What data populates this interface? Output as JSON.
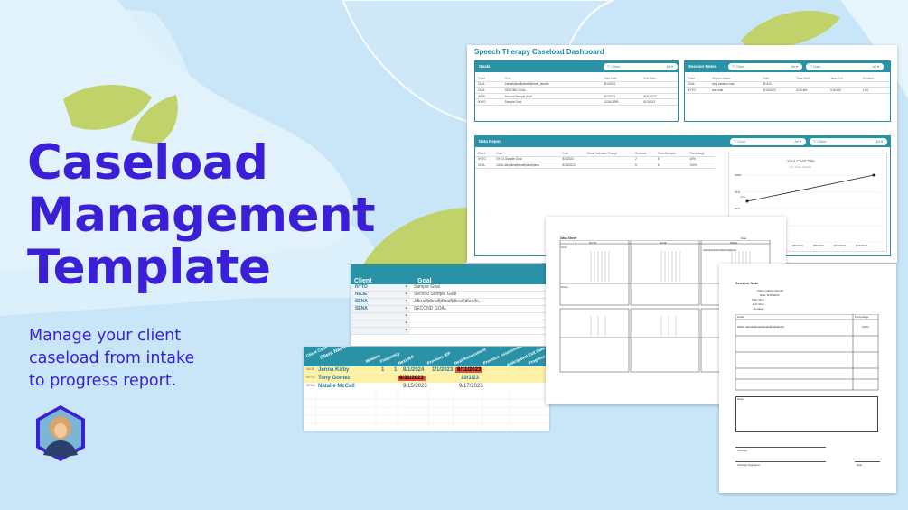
{
  "hero": {
    "title_line1": "Caseload",
    "title_line2": "Management",
    "title_line3": "Template",
    "subtitle_line1": "Manage your client",
    "subtitle_line2": "caseload from intake",
    "subtitle_line3": "to progress report."
  },
  "colors": {
    "accent": "#3a1fd6",
    "teal": "#2a92a6",
    "bg": "#c9e6f8",
    "olive": "#c2d26a"
  },
  "dashboard": {
    "title": "Speech Therapy Caseload Dashboard",
    "goals_panel": {
      "title": "Goals",
      "filter_label": "Client",
      "filter_value": "All",
      "headers": [
        "Client",
        "Goal",
        "Start Date",
        "End Date"
      ],
      "rows": [
        [
          "CIAA",
          "Jdkraif|dkraifl|dkraifl|dkraifl_dkraifo",
          "8/1/2023",
          ""
        ],
        [
          "CIAA",
          "SECOND GOAL",
          "",
          ""
        ],
        [
          "NAJE",
          "Second Sample Goal",
          "8/1/2023",
          "8/31/2023"
        ],
        [
          "NYTO",
          "Sample Goal",
          "12/31/1899",
          "8/1/2023"
        ]
      ]
    },
    "notes_panel": {
      "title": "Session Notes",
      "filter1_label": "Client",
      "filter1_value": "All",
      "filter2_label": "Date",
      "filter2_value": "All",
      "headers": [
        "Client",
        "Session Notes",
        "Date",
        "Time Start",
        "Time End",
        "Duration"
      ],
      "rows": [
        [
          "CINA",
          "long session note",
          "8/10/23",
          "",
          "",
          ""
        ],
        [
          "NYTO",
          "test note",
          "8/15/2023",
          "8:30 AM",
          "9:30 AM",
          "1:00"
        ]
      ]
    },
    "data_panel": {
      "title": "Data Report",
      "filter1_label": "Goal",
      "filter1_value": "All",
      "filter2_label": "Client",
      "filter2_value": "All",
      "headers": [
        "Client",
        "Goal",
        "Date",
        "Mode Indicates Prompt",
        "Success",
        "Total Attempts",
        "Percentage"
      ],
      "rows": [
        [
          "NYTO",
          "NYTO-Sample Goal",
          "8/3/2023",
          "",
          "2",
          "5",
          "40%"
        ],
        [
          "CINA",
          "CINA-Jdkr|dkraif|dkraif|dkraif|dkra",
          "8/15/2023",
          "",
          "6",
          "6",
          "100%"
        ]
      ],
      "chart": {
        "title": "Your Chart Title",
        "subtitle": "Your Chart Subtitle",
        "y_ticks": [
          "100%",
          "75%",
          "50%"
        ],
        "x_ticks": [
          "8/3/2023",
          "8/6/2023",
          "8/9/2023",
          "8/12/2023",
          "8/15/2023"
        ],
        "label_40": "40%"
      }
    }
  },
  "goals_sheet": {
    "col_client": "Client",
    "col_goal": "Goal",
    "rows": [
      {
        "client": "NYTO",
        "goal": "Sample Goal"
      },
      {
        "client": "NAJE",
        "goal": "Second Sample Goal"
      },
      {
        "client": "SENA",
        "goal": "Jdkraif|dkraif|dkraif|dkraif|dkraifo,"
      },
      {
        "client": "SENA",
        "goal": "SECOND GOAL"
      }
    ]
  },
  "tracking_sheet": {
    "headers": [
      "Client Code",
      "Client Name",
      "Minutes",
      "Frequency",
      "Next IEP",
      "Previous IEP",
      "Next Assessment",
      "Previous Assessment",
      "Anticipated Exit Date",
      "Progress Report"
    ],
    "rows": [
      {
        "code": "NAJE",
        "name": "Jenna Kirby",
        "minutes": "1",
        "freq": "1",
        "next_iep": "8/1/2024",
        "prev_iep": "1/1/2023",
        "next_assess": "8/11/2023",
        "prev_assess": ""
      },
      {
        "code": "NYTO",
        "name": "Tony Gomez",
        "minutes": "",
        "freq": "",
        "next_iep": "8/31/2023",
        "prev_iep": "",
        "next_assess": "10/1/23",
        "prev_assess": ""
      },
      {
        "code": "SENA",
        "name": "Natalie McCall",
        "minutes": "",
        "freq": "",
        "next_iep": "9/15/2023",
        "prev_iep": "",
        "next_assess": "9/17/2023",
        "prev_assess": ""
      }
    ]
  },
  "data_sheet": {
    "title": "Data Sheet",
    "date_label": "Date",
    "col1": "NYTO",
    "col2": "NAJE",
    "col3": "SENA",
    "goal_label": "Goal",
    "notes_label": "Notes",
    "sena_goal": "Jdkraif|dkraif|dkraif|dkraif|dkraifo"
  },
  "session_note": {
    "title": "Session Note",
    "client_label": "Client:",
    "client_value": "Natalie McCall",
    "date_label": "Date:",
    "date_value": "8/15/2023",
    "start_label": "Start Time:",
    "end_label": "End Time:",
    "duration_label": "Duration:",
    "goals_header": "Goals",
    "percentage_header": "Percentage",
    "goal_row": "SENA-Jdkraif|dkraif|dkraif|dkraif|dkraifo",
    "goal_pct": "100%",
    "notes_header": "Notes",
    "clinician_label": "Clinician",
    "signature_label": "Clinician Signature",
    "date2_label": "Date"
  }
}
